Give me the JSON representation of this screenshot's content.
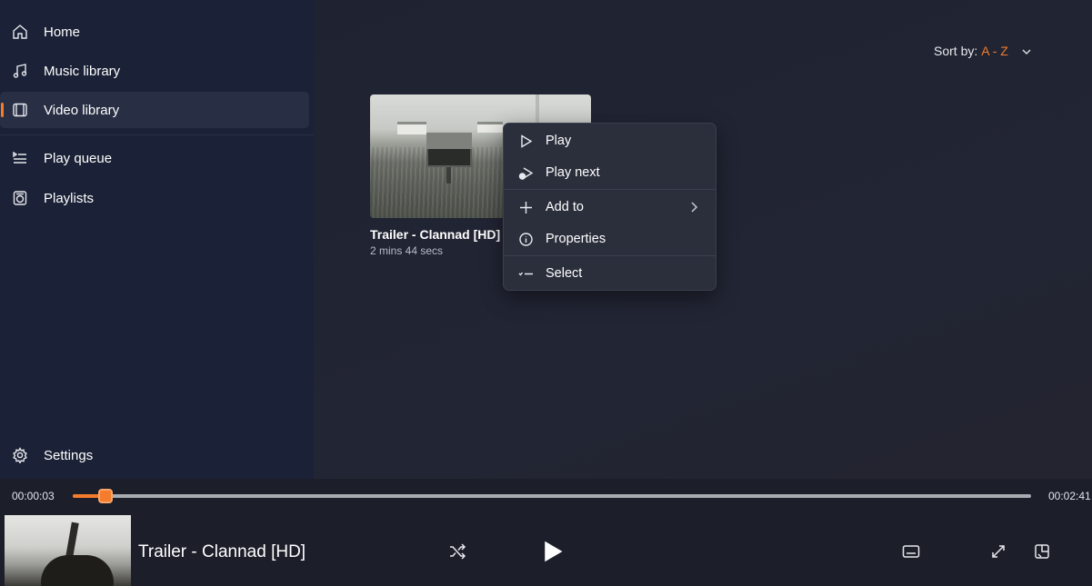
{
  "sidebar": {
    "items": [
      {
        "label": "Home",
        "icon": "home-icon"
      },
      {
        "label": "Music library",
        "icon": "music-icon"
      },
      {
        "label": "Video library",
        "icon": "film-icon",
        "active": true
      },
      {
        "label": "Play queue",
        "icon": "queue-icon"
      },
      {
        "label": "Playlists",
        "icon": "playlist-icon"
      }
    ],
    "settings": {
      "label": "Settings",
      "icon": "gear-icon"
    }
  },
  "main": {
    "sort": {
      "label": "Sort by:",
      "value": "A - Z"
    },
    "videos": [
      {
        "title": "Trailer - Clannad [HD]",
        "duration": "2 mins 44 secs"
      }
    ]
  },
  "context_menu": {
    "items": [
      {
        "label": "Play",
        "icon": "play-icon"
      },
      {
        "label": "Play next",
        "icon": "play-next-icon"
      },
      {
        "label": "Add to",
        "icon": "plus-icon",
        "submenu": true
      },
      {
        "label": "Properties",
        "icon": "info-icon"
      },
      {
        "label": "Select",
        "icon": "select-icon"
      }
    ]
  },
  "player": {
    "elapsed": "00:00:03",
    "total": "00:02:41",
    "progress_fraction": 0.03,
    "now_playing_title": "Trailer - Clannad [HD]"
  },
  "colors": {
    "accent": "#f47c2c",
    "sidebar": "#1b2136",
    "background": "#1e2230"
  }
}
